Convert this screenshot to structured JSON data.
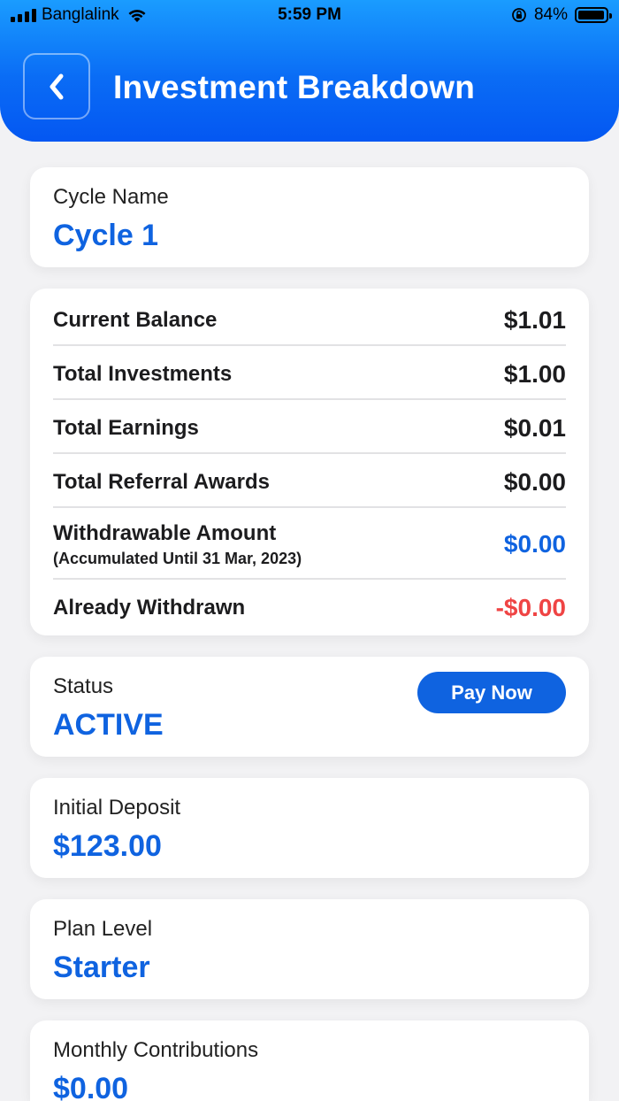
{
  "status_bar": {
    "carrier": "Banglalink",
    "time": "5:59 PM",
    "battery": "84%"
  },
  "header": {
    "title": "Investment Breakdown",
    "back_icon": "chevron-left-icon"
  },
  "cycle": {
    "label": "Cycle Name",
    "value": "Cycle 1"
  },
  "summary": {
    "rows": [
      {
        "label": "Current Balance",
        "value": "$1.01"
      },
      {
        "label": "Total Investments",
        "value": "$1.00"
      },
      {
        "label": "Total Earnings",
        "value": "$0.01"
      },
      {
        "label": "Total Referral Awards",
        "value": "$0.00"
      },
      {
        "label": "Withdrawable Amount",
        "sublabel": "(Accumulated Until 31 Mar, 2023)",
        "value": "$0.00"
      },
      {
        "label": "Already Withdrawn",
        "value": "-$0.00"
      }
    ]
  },
  "status": {
    "label": "Status",
    "value": "ACTIVE",
    "button": "Pay Now"
  },
  "deposit": {
    "label": "Initial Deposit",
    "value": "$123.00"
  },
  "plan": {
    "label": "Plan Level",
    "value": "Starter"
  },
  "monthly": {
    "label": "Monthly Contributions",
    "value": "$0.00"
  },
  "colors": {
    "accent": "#0f63e0",
    "negative": "#ef4444",
    "header_top": "#1a9cff",
    "header_bottom": "#0457f2"
  }
}
